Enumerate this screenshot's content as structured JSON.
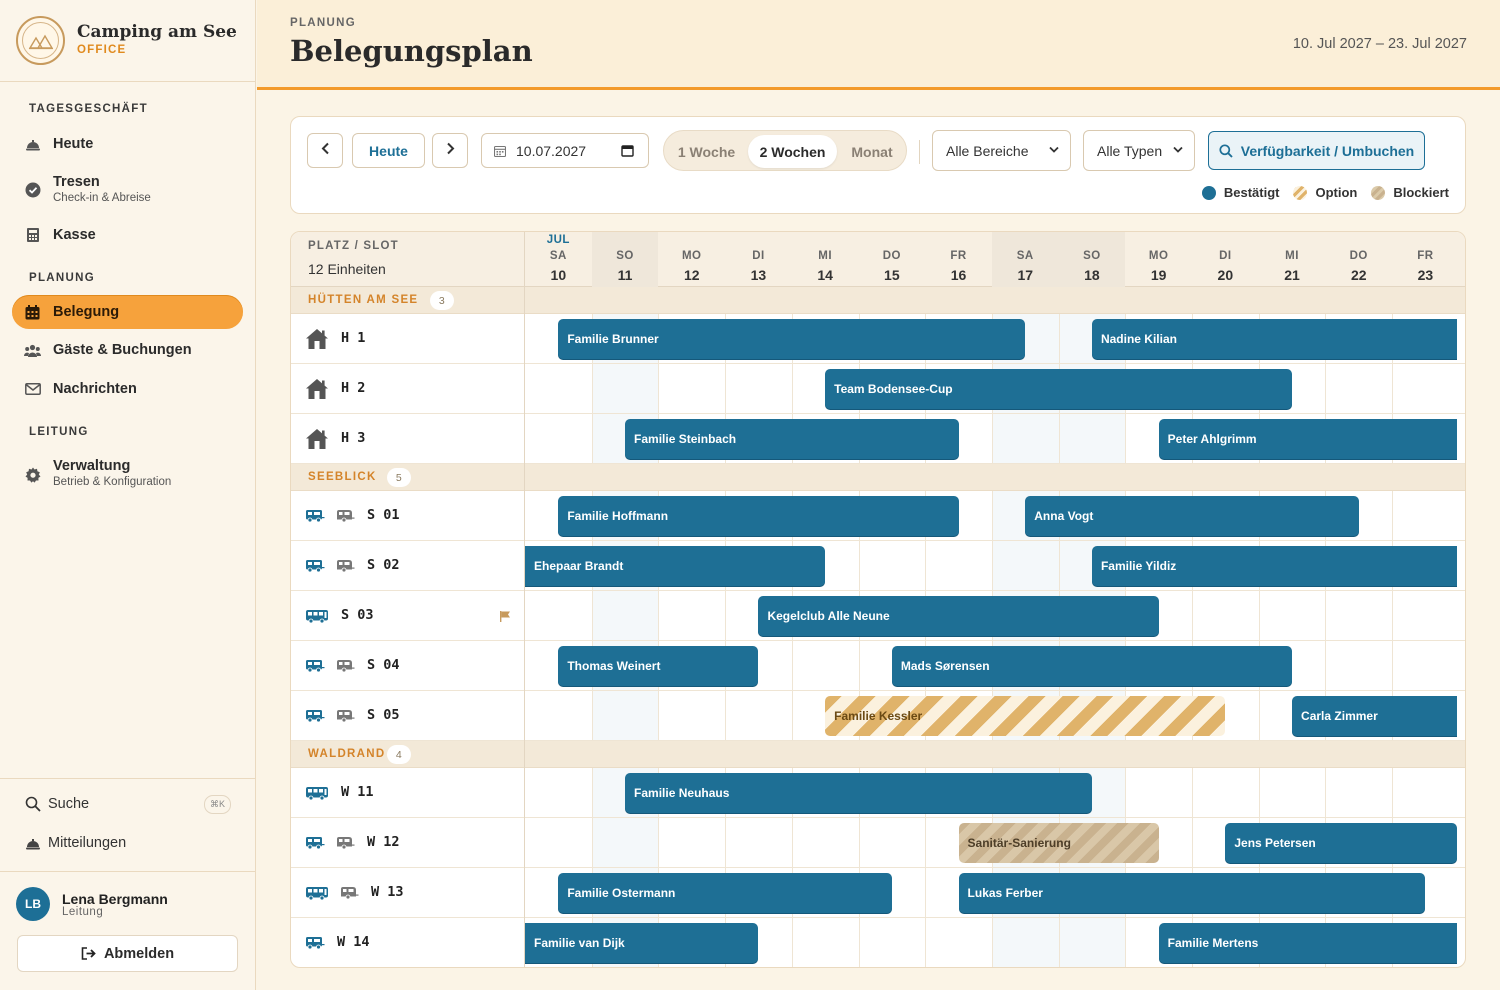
{
  "brand": {
    "name": "Camping am See",
    "sub": "OFFICE"
  },
  "nav": {
    "sections": [
      "TAGESGESCHÄFT",
      "PLANUNG",
      "LEITUNG"
    ],
    "items": [
      {
        "label": "Heute",
        "sub": "",
        "icon": "bell-icon"
      },
      {
        "label": "Tresen",
        "sub": "Check-in & Abreise",
        "icon": "check-circle-icon"
      },
      {
        "label": "Kasse",
        "sub": "",
        "icon": "cash-register-icon"
      },
      {
        "label": "Belegung",
        "sub": "",
        "icon": "calendar-icon",
        "active": true
      },
      {
        "label": "Gäste & Buchungen",
        "sub": "",
        "icon": "users-icon"
      },
      {
        "label": "Nachrichten",
        "sub": "",
        "icon": "envelope-icon"
      },
      {
        "label": "Verwaltung",
        "sub": "Betrieb & Konfiguration",
        "icon": "gear-icon"
      }
    ]
  },
  "utility": {
    "search": "Suche",
    "search_kbd": "⌘K",
    "notifications": "Mitteilungen"
  },
  "user": {
    "initials": "LB",
    "name": "Lena Bergmann",
    "role": "Leitung",
    "logout": "Abmelden"
  },
  "header": {
    "crumb": "PLANUNG",
    "title": "Belegungsplan",
    "range": "10. Jul 2027 – 23. Jul 2027"
  },
  "toolbar": {
    "today": "Heute",
    "date": "10.07.2027",
    "views": [
      "1 Woche",
      "2 Wochen",
      "Monat"
    ],
    "active_view": "2 Wochen",
    "area_select": "Alle Bereiche",
    "type_select": "Alle Typen",
    "availability": "Verfügbarkeit / Umbuchen",
    "legend": [
      {
        "label": "Bestätigt",
        "color": "#1e6f95"
      },
      {
        "label": "Option",
        "color": "#e0b36a"
      },
      {
        "label": "Blockiert",
        "color": "#c9b28f"
      }
    ]
  },
  "grid": {
    "slot_header": "PLATZ / SLOT",
    "unit_count": "12 Einheiten",
    "month": "JUL",
    "days": [
      {
        "dn": "SA",
        "dd": "10",
        "we": false
      },
      {
        "dn": "SO",
        "dd": "11",
        "we": true
      },
      {
        "dn": "MO",
        "dd": "12",
        "we": false
      },
      {
        "dn": "DI",
        "dd": "13",
        "we": false
      },
      {
        "dn": "MI",
        "dd": "14",
        "we": false
      },
      {
        "dn": "DO",
        "dd": "15",
        "we": false
      },
      {
        "dn": "FR",
        "dd": "16",
        "we": false
      },
      {
        "dn": "SA",
        "dd": "17",
        "we": true
      },
      {
        "dn": "SO",
        "dd": "18",
        "we": true
      },
      {
        "dn": "MO",
        "dd": "19",
        "we": false
      },
      {
        "dn": "DI",
        "dd": "20",
        "we": false
      },
      {
        "dn": "MI",
        "dd": "21",
        "we": false
      },
      {
        "dn": "DO",
        "dd": "22",
        "we": false
      },
      {
        "dn": "FR",
        "dd": "23",
        "we": false
      }
    ],
    "groups": [
      {
        "name": "HÜTTEN AM SEE",
        "count": "3",
        "rows": [
          {
            "name": "H 1",
            "icons": [
              "house"
            ],
            "bookings": [
              {
                "label": "Familie Brunner",
                "start": 10,
                "end": 17,
                "status": "confirmed"
              },
              {
                "label": "Nadine Kilian",
                "start": 18,
                "end": 24,
                "status": "confirmed"
              }
            ]
          },
          {
            "name": "H 2",
            "icons": [
              "house"
            ],
            "bookings": [
              {
                "label": "Team Bodensee-Cup",
                "start": 14,
                "end": 21,
                "status": "confirmed"
              }
            ]
          },
          {
            "name": "H 3",
            "icons": [
              "house"
            ],
            "bookings": [
              {
                "label": "Familie Steinbach",
                "start": 11,
                "end": 16,
                "status": "confirmed"
              },
              {
                "label": "Peter Ahlgrimm",
                "start": 19,
                "end": 24,
                "status": "confirmed"
              }
            ]
          }
        ]
      },
      {
        "name": "SEEBLICK",
        "count": "5",
        "rows": [
          {
            "name": "S 01",
            "icons": [
              "camper",
              "caravan"
            ],
            "bookings": [
              {
                "label": "Familie Hoffmann",
                "start": 10,
                "end": 16,
                "status": "confirmed"
              },
              {
                "label": "Anna Vogt",
                "start": 17,
                "end": 22,
                "status": "confirmed"
              }
            ]
          },
          {
            "name": "S 02",
            "icons": [
              "camper",
              "caravan"
            ],
            "bookings": [
              {
                "label": "Ehepaar Brandt",
                "start": 9.5,
                "end": 14,
                "status": "confirmed"
              },
              {
                "label": "Familie Yildiz",
                "start": 18,
                "end": 24,
                "status": "confirmed"
              }
            ]
          },
          {
            "name": "S 03",
            "icons": [
              "bus"
            ],
            "flag": true,
            "bookings": [
              {
                "label": "Kegelclub Alle Neune",
                "start": 13,
                "end": 19,
                "status": "confirmed"
              }
            ]
          },
          {
            "name": "S 04",
            "icons": [
              "camper",
              "caravan"
            ],
            "bookings": [
              {
                "label": "Thomas Weinert",
                "start": 10,
                "end": 13,
                "status": "confirmed"
              },
              {
                "label": "Mads Sørensen",
                "start": 15,
                "end": 21,
                "status": "confirmed"
              }
            ]
          },
          {
            "name": "S 05",
            "icons": [
              "camper",
              "caravan"
            ],
            "bookings": [
              {
                "label": "Familie Kessler",
                "start": 14,
                "end": 20,
                "status": "option"
              },
              {
                "label": "Carla Zimmer",
                "start": 21,
                "end": 24,
                "status": "confirmed"
              }
            ]
          }
        ]
      },
      {
        "name": "WALDRAND",
        "count": "4",
        "rows": [
          {
            "name": "W 11",
            "icons": [
              "bus"
            ],
            "bookings": [
              {
                "label": "Familie Neuhaus",
                "start": 11,
                "end": 18,
                "status": "confirmed"
              }
            ]
          },
          {
            "name": "W 12",
            "icons": [
              "camper",
              "caravan"
            ],
            "bookings": [
              {
                "label": "Sanitär-Sanierung",
                "start": 16,
                "end": 19,
                "status": "blocked"
              },
              {
                "label": "Jens Petersen",
                "start": 20,
                "end": 23.5,
                "status": "confirmed"
              }
            ]
          },
          {
            "name": "W 13",
            "icons": [
              "bus",
              "caravan"
            ],
            "bookings": [
              {
                "label": "Familie Ostermann",
                "start": 10,
                "end": 15,
                "status": "confirmed"
              },
              {
                "label": "Lukas Ferber",
                "start": 16,
                "end": 23,
                "status": "confirmed"
              }
            ]
          },
          {
            "name": "W 14",
            "icons": [
              "camper"
            ],
            "bookings": [
              {
                "label": "Familie van Dijk",
                "start": 9.5,
                "end": 13,
                "status": "confirmed"
              },
              {
                "label": "Familie Mertens",
                "start": 19,
                "end": 24,
                "status": "confirmed"
              }
            ]
          }
        ]
      }
    ]
  }
}
